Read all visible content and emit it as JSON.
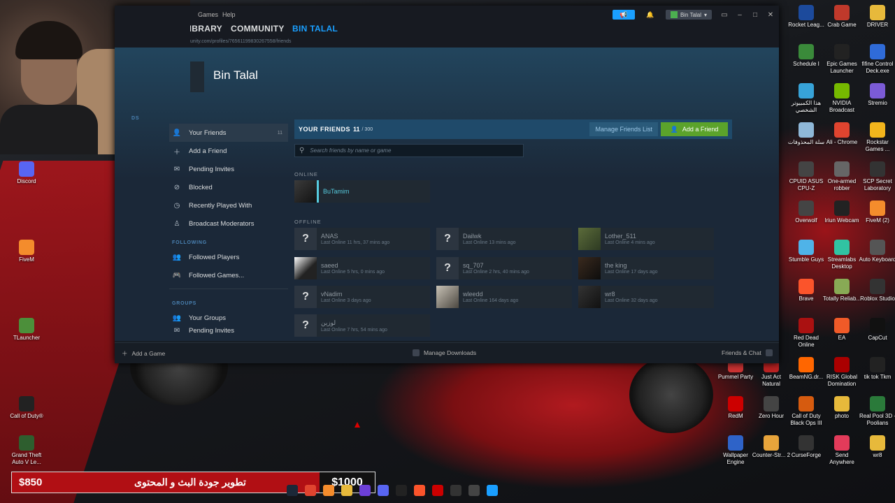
{
  "steam": {
    "menu": [
      "Games",
      "Help"
    ],
    "nav": [
      "LIBRARY",
      "COMMUNITY",
      "BIN TALAL"
    ],
    "url": "unity.com/profiles/76561199830267558/friends",
    "account_name": "Bin Talal",
    "profile_name": "Bin Talal",
    "sidebar": {
      "label_top": "DS",
      "items": [
        {
          "label": "Your Friends",
          "count": "11"
        },
        {
          "label": "Add a Friend"
        },
        {
          "label": "Pending Invites"
        },
        {
          "label": "Blocked"
        },
        {
          "label": "Recently Played With"
        },
        {
          "label": "Broadcast Moderators"
        }
      ],
      "following_label": "FOLLOWING",
      "following": [
        {
          "label": "Followed Players"
        },
        {
          "label": "Followed Games..."
        }
      ],
      "groups_label": "GROUPS",
      "groups": [
        {
          "label": "Your Groups"
        },
        {
          "label": "Pending Invites"
        }
      ]
    },
    "friends_header": {
      "title": "YOUR FRIENDS",
      "count": "11",
      "max": "/ 300",
      "manage": "Manage Friends List",
      "add": "Add a Friend"
    },
    "search_placeholder": "Search friends by name or game",
    "online_label": "ONLINE",
    "offline_label": "OFFLINE",
    "online_friends": [
      {
        "name": "BuTamim",
        "status": ""
      }
    ],
    "offline_friends": [
      {
        "name": "ANAS",
        "status": "Last Online 11 hrs, 37 mins ago"
      },
      {
        "name": "Dailwk",
        "status": "Last Online 13 mins ago"
      },
      {
        "name": "Lother_511",
        "status": "Last Online 4 mins ago"
      },
      {
        "name": "saeed",
        "status": "Last Online 5 hrs, 0 mins ago"
      },
      {
        "name": "sq_707",
        "status": "Last Online 2 hrs, 40 mins ago"
      },
      {
        "name": "the king",
        "status": "Last Online 17 days ago"
      },
      {
        "name": "vNadim",
        "status": "Last Online 3 days ago"
      },
      {
        "name": "wleedd",
        "status": "Last Online 164 days ago"
      },
      {
        "name": "wr8",
        "status": "Last Online 32 days ago"
      },
      {
        "name": "لوزين",
        "status": "Last Online 7 hrs, 54 mins ago"
      }
    ],
    "bottom": {
      "add_game": "Add a Game",
      "downloads": "Manage Downloads",
      "friends_chat": "Friends & Chat"
    }
  },
  "desktop_icons": [
    {
      "label": "Discord",
      "icon": "discord-icon",
      "color": "#5865f2"
    },
    {
      "label": "FiveM",
      "icon": "fivem-icon",
      "color": "#f48c2c"
    },
    {
      "label": "TLauncher",
      "icon": "minecraft-icon",
      "color": "#4c8f3a"
    },
    {
      "label": "Call of Duty®",
      "icon": "cod-icon",
      "color": "#222"
    },
    {
      "label": "Grand Theft Auto V Le...",
      "icon": "gta-icon",
      "color": "#2e5e2e"
    },
    {
      "label": "Rocket Leag...",
      "icon": "rocket-league-icon",
      "color": "#1c4a9c"
    },
    {
      "label": "Crab Game",
      "icon": "crab-game-icon",
      "color": "#c0392b"
    },
    {
      "label": "DRIVER",
      "icon": "folder-icon",
      "color": "#e7b93b"
    },
    {
      "label": "Schedule I",
      "icon": "schedule-icon",
      "color": "#3a8a3a"
    },
    {
      "label": "Epic Games Launcher",
      "icon": "epic-icon",
      "color": "#222"
    },
    {
      "label": "fifine Control Deck.exe",
      "icon": "fifine-icon",
      "color": "#2f6bd8"
    },
    {
      "label": "هذا الكمبيوتر الشخصي",
      "icon": "pc-icon",
      "color": "#37a3d8"
    },
    {
      "label": "NVIDIA Broadcast",
      "icon": "nvidia-icon",
      "color": "#76b900"
    },
    {
      "label": "Stremio",
      "icon": "stremio-icon",
      "color": "#7b5bd6"
    },
    {
      "label": "سلة المحذوفات",
      "icon": "recycle-bin-icon",
      "color": "#8fb8d8"
    },
    {
      "label": "Ali - Chrome",
      "icon": "chrome-icon",
      "color": "#e0442f"
    },
    {
      "label": "Rockstar Games ...",
      "icon": "rockstar-icon",
      "color": "#f2b51c"
    },
    {
      "label": "CPUID ASUS CPU-Z",
      "icon": "cpuz-icon",
      "color": "#444"
    },
    {
      "label": "One-armed robber",
      "icon": "robber-icon",
      "color": "#666"
    },
    {
      "label": "SCP Secret Laboratory",
      "icon": "scp-icon",
      "color": "#333"
    },
    {
      "label": "Overwolf",
      "icon": "overwolf-icon",
      "color": "#444"
    },
    {
      "label": "Iriun Webcam",
      "icon": "iriun-icon",
      "color": "#222"
    },
    {
      "label": "FiveM (2)",
      "icon": "fivem-icon",
      "color": "#f48c2c"
    },
    {
      "label": "Stumble Guys",
      "icon": "stumble-icon",
      "color": "#4fb3e8"
    },
    {
      "label": "Streamlabs Desktop",
      "icon": "streamlabs-icon",
      "color": "#31c3a2"
    },
    {
      "label": "Auto Keyboard",
      "icon": "keyboard-icon",
      "color": "#555"
    },
    {
      "label": "Brave",
      "icon": "brave-icon",
      "color": "#fb542b"
    },
    {
      "label": "Totally Reliab...",
      "icon": "delivery-icon",
      "color": "#8a5"
    },
    {
      "label": "Roblox Studio",
      "icon": "roblox-icon",
      "color": "#333"
    },
    {
      "label": "Red Dead Online",
      "icon": "rdo-icon",
      "color": "#a11"
    },
    {
      "label": "EA",
      "icon": "ea-icon",
      "color": "#f05a28"
    },
    {
      "label": "CapCut",
      "icon": "capcut-icon",
      "color": "#111"
    },
    {
      "label": "Pummel Party",
      "icon": "pummel-icon",
      "color": "#c33"
    },
    {
      "label": "Just Act Natural",
      "icon": "jan-icon",
      "color": "#b22"
    },
    {
      "label": "BeamNG.dr...",
      "icon": "beamng-icon",
      "color": "#f60"
    },
    {
      "label": "RISK Global Domination",
      "icon": "risk-icon",
      "color": "#a00"
    },
    {
      "label": "tik tok Tkm",
      "icon": "tiktok-icon",
      "color": "#222"
    },
    {
      "label": "RedM",
      "icon": "redm-icon",
      "color": "#c00"
    },
    {
      "label": "Zero Hour",
      "icon": "zero-hour-icon",
      "color": "#444"
    },
    {
      "label": "Call of Duty Black Ops III",
      "icon": "bo3-icon",
      "color": "#d65b0f"
    },
    {
      "label": "photo",
      "icon": "folder-icon",
      "color": "#e7b93b"
    },
    {
      "label": "Real Pool 3D - Poolians",
      "icon": "pool-icon",
      "color": "#2a7a3a"
    },
    {
      "label": "Wallpaper Engine",
      "icon": "wallpaper-icon",
      "color": "#2e63c8"
    },
    {
      "label": "Counter-Str... 2",
      "icon": "cs2-icon",
      "color": "#e7a43b"
    },
    {
      "label": "CurseForge",
      "icon": "curseforge-icon",
      "color": "#333"
    },
    {
      "label": "Send Anywhere",
      "icon": "send-anywhere-icon",
      "color": "#e23b5a"
    },
    {
      "label": "wr8",
      "icon": "folder-icon",
      "color": "#e7b93b"
    }
  ],
  "banner": {
    "current": "$850",
    "goal_text": "تطوير جودة البث و المحتوى",
    "target": "$1000"
  },
  "taskbar": [
    {
      "icon": "steam-icon",
      "color": "#1b2838"
    },
    {
      "icon": "chrome-icon",
      "color": "#e0442f"
    },
    {
      "icon": "fivem-icon",
      "color": "#f48c2c"
    },
    {
      "icon": "folder-icon",
      "color": "#e7b93b"
    },
    {
      "icon": "obs-icon",
      "color": "#6c3fd8"
    },
    {
      "icon": "discord-icon",
      "color": "#5865f2"
    },
    {
      "icon": "tiktok-icon",
      "color": "#222"
    },
    {
      "icon": "brave-icon",
      "color": "#fb542b"
    },
    {
      "icon": "roblox-icon",
      "color": "#c00"
    },
    {
      "icon": "capcut-icon",
      "color": "#333"
    },
    {
      "icon": "store-icon",
      "color": "#444"
    },
    {
      "icon": "windows-icon",
      "color": "#1a9fff"
    }
  ]
}
